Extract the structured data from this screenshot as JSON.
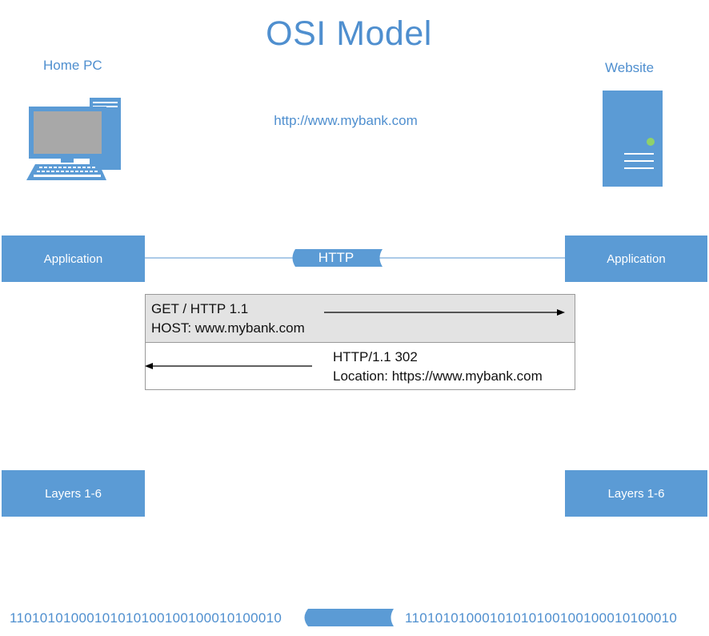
{
  "diagram": {
    "title": "OSI Model",
    "client_label": "Home PC",
    "server_label": "Website",
    "url": "http://www.mybank.com",
    "layers": {
      "application_left": "Application",
      "application_right": "Application",
      "lower_left": "Layers 1-6",
      "lower_right": "Layers 1-6"
    },
    "protocol_label": "HTTP",
    "request": {
      "line1": "GET / HTTP 1.1",
      "line2": "HOST: www.mybank.com"
    },
    "response": {
      "line1": "HTTP/1.1 302",
      "line2": "Location: https://www.mybank.com"
    },
    "binary": {
      "left": "11010101000101010100100100010100010",
      "right": "11010101000101010100100100010100010"
    },
    "colors": {
      "accent": "#5b9bd5",
      "text_accent": "#4f8fcf",
      "request_fill": "#e3e3e3"
    }
  }
}
